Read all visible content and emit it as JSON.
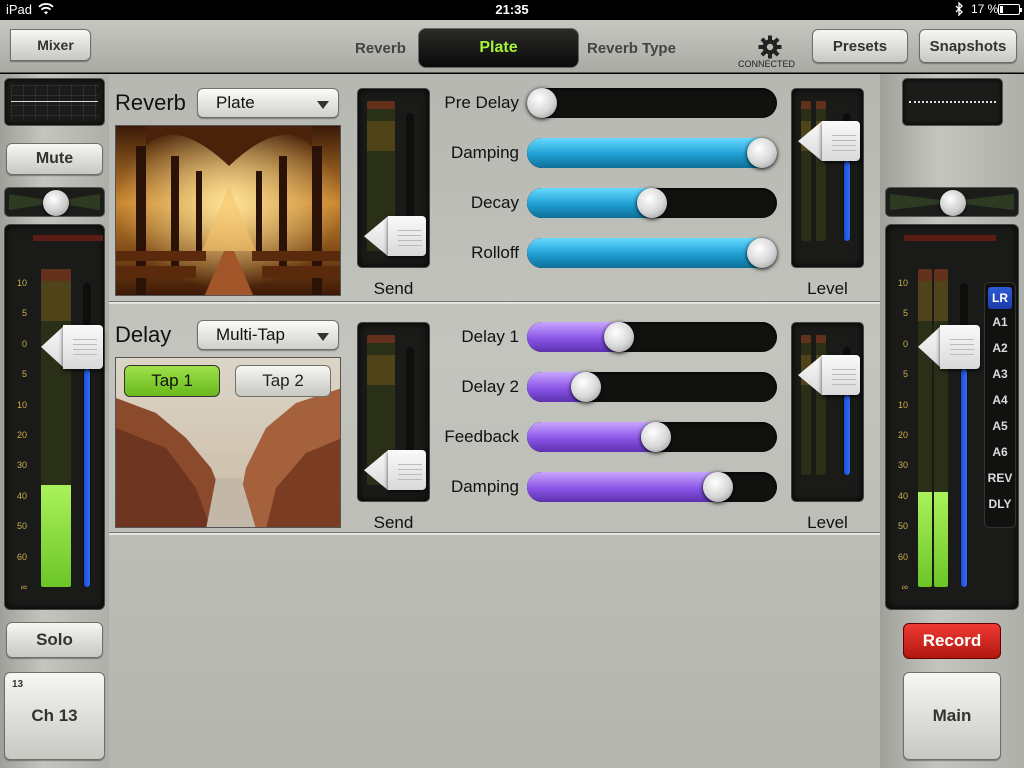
{
  "statusbar": {
    "device": "iPad",
    "time": "21:35",
    "battery_pct": "17 %",
    "battery_level": 0.17
  },
  "toolbar": {
    "back_label": "Mixer",
    "reverb_label": "Reverb",
    "type_value": "Plate",
    "type_label": "Reverb Type",
    "connected": "CONNECTED",
    "presets": "Presets",
    "snapshots": "Snapshots",
    "accent_color": "#a6f23c"
  },
  "left_strip": {
    "mute": "Mute",
    "solo": "Solo",
    "channel_number": "13",
    "channel_name": "Ch 13",
    "scale": [
      "10",
      "5",
      "0",
      "5",
      "10",
      "20",
      "30",
      "40",
      "50",
      "60",
      "∞"
    ],
    "pan": 0.5,
    "meter_level": 0.32,
    "fader_level": 0.79
  },
  "right_strip": {
    "record": "Record",
    "main": "Main",
    "scale": [
      "10",
      "5",
      "0",
      "5",
      "10",
      "20",
      "30",
      "40",
      "50",
      "60",
      "∞"
    ],
    "pan": 0.5,
    "meter_level": 0.3,
    "fader_level": 0.79,
    "buses": [
      "LR",
      "A1",
      "A2",
      "A3",
      "A4",
      "A5",
      "A6",
      "REV",
      "DLY"
    ],
    "selected_bus": "LR"
  },
  "reverb": {
    "title": "Reverb",
    "type": "Plate",
    "send_label": "Send",
    "level_label": "Level",
    "send_level": 0.12,
    "out_level": 0.78,
    "params": [
      {
        "label": "Pre Delay",
        "value": 0.0
      },
      {
        "label": "Damping",
        "value": 1.0
      },
      {
        "label": "Decay",
        "value": 0.5
      },
      {
        "label": "Rolloff",
        "value": 1.0
      }
    ],
    "param_color": "#1f9ed2"
  },
  "delay": {
    "title": "Delay",
    "type": "Multi-Tap",
    "tap1": "Tap 1",
    "tap2": "Tap 2",
    "send_label": "Send",
    "level_label": "Level",
    "send_level": 0.12,
    "out_level": 0.78,
    "params": [
      {
        "label": "Delay 1",
        "value": 0.35
      },
      {
        "label": "Delay 2",
        "value": 0.2
      },
      {
        "label": "Feedback",
        "value": 0.52
      },
      {
        "label": "Damping",
        "value": 0.8
      }
    ],
    "param_color": "#8a55e6"
  }
}
